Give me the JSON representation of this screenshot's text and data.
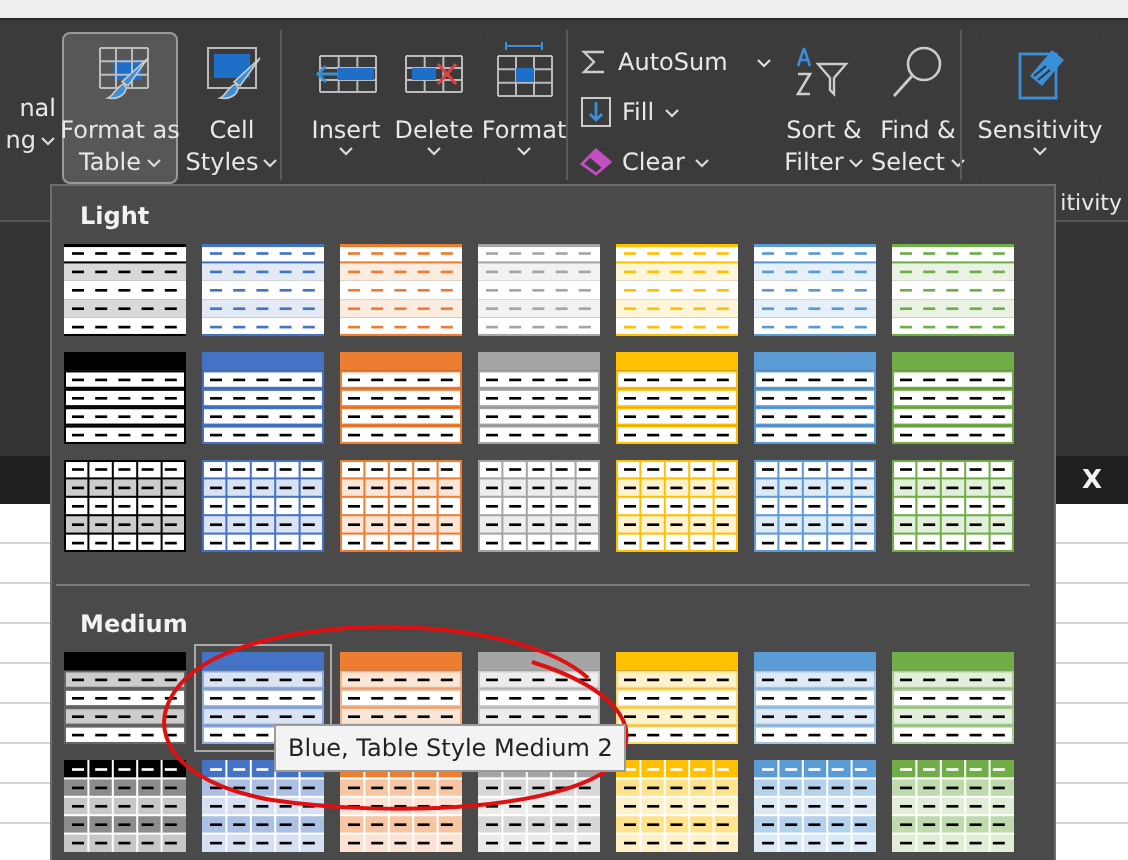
{
  "ribbon": {
    "groups": [
      {
        "buttons": [
          {
            "kind": "cut",
            "lines": [
              "nal",
              "ng"
            ],
            "dropdown": true
          }
        ]
      },
      {
        "buttons": [
          {
            "kind": "large",
            "lines": [
              "Format as",
              "Table"
            ],
            "dropdown": true,
            "pressed": true
          },
          {
            "kind": "large",
            "lines": [
              "Cell",
              "Styles"
            ],
            "dropdown": true,
            "pressed": false
          }
        ]
      },
      {
        "buttons": [
          {
            "kind": "large",
            "lines": [
              "Insert"
            ],
            "dropdown": true,
            "pressed": false
          },
          {
            "kind": "large",
            "lines": [
              "Delete"
            ],
            "dropdown": true,
            "pressed": false
          },
          {
            "kind": "large",
            "lines": [
              "Format"
            ],
            "dropdown": true,
            "pressed": false
          }
        ]
      },
      {
        "buttons": [
          {
            "kind": "stack",
            "items": [
              {
                "label": "AutoSum",
                "dropdown": true,
                "split": true
              },
              {
                "label": "Fill",
                "dropdown": true,
                "split": false
              },
              {
                "label": "Clear",
                "dropdown": true,
                "split": false
              }
            ]
          },
          {
            "kind": "large",
            "lines": [
              "Sort &",
              "Filter"
            ],
            "dropdown": true,
            "pressed": false
          },
          {
            "kind": "large",
            "lines": [
              "Find &",
              "Select"
            ],
            "dropdown": true,
            "pressed": false
          }
        ]
      },
      {
        "buttons": [
          {
            "kind": "large",
            "lines": [
              "Sensitivity"
            ],
            "dropdown": true,
            "pressed": false
          }
        ],
        "label": "itivity"
      }
    ]
  },
  "formula_bar": {
    "cancel": "X"
  },
  "gallery": {
    "sections": [
      {
        "title": "Light",
        "rows": [
          [
            {
              "kind": "light-banded",
              "color": "#000000",
              "selected": false
            },
            {
              "kind": "light-banded",
              "color": "#4472c4",
              "selected": false
            },
            {
              "kind": "light-banded",
              "color": "#ed7d31",
              "selected": false
            },
            {
              "kind": "light-banded",
              "color": "#a5a5a5",
              "selected": false
            },
            {
              "kind": "light-banded",
              "color": "#ffc000",
              "selected": false
            },
            {
              "kind": "light-banded",
              "color": "#5b9bd5",
              "selected": false
            },
            {
              "kind": "light-banded",
              "color": "#70ad47",
              "selected": false
            }
          ],
          [
            {
              "kind": "light-header",
              "color": "#000000",
              "selected": false
            },
            {
              "kind": "light-header",
              "color": "#4472c4",
              "selected": false
            },
            {
              "kind": "light-header",
              "color": "#ed7d31",
              "selected": false
            },
            {
              "kind": "light-header",
              "color": "#a5a5a5",
              "selected": false
            },
            {
              "kind": "light-header",
              "color": "#ffc000",
              "selected": false
            },
            {
              "kind": "light-header",
              "color": "#5b9bd5",
              "selected": false
            },
            {
              "kind": "light-header",
              "color": "#70ad47",
              "selected": false
            }
          ],
          [
            {
              "kind": "light-grid",
              "color": "#000000",
              "selected": false
            },
            {
              "kind": "light-grid",
              "color": "#4472c4",
              "selected": false
            },
            {
              "kind": "light-grid",
              "color": "#ed7d31",
              "selected": false
            },
            {
              "kind": "light-grid",
              "color": "#a5a5a5",
              "selected": false
            },
            {
              "kind": "light-grid",
              "color": "#ffc000",
              "selected": false
            },
            {
              "kind": "light-grid",
              "color": "#5b9bd5",
              "selected": false
            },
            {
              "kind": "light-grid",
              "color": "#70ad47",
              "selected": false
            }
          ]
        ]
      },
      {
        "title": "Medium",
        "rows": [
          [
            {
              "kind": "medium-banded",
              "color": "#000000",
              "selected": false
            },
            {
              "kind": "medium-banded",
              "color": "#4472c4",
              "selected": true
            },
            {
              "kind": "medium-banded",
              "color": "#ed7d31",
              "selected": false
            },
            {
              "kind": "medium-banded",
              "color": "#a5a5a5",
              "selected": false
            },
            {
              "kind": "medium-banded",
              "color": "#ffc000",
              "selected": false
            },
            {
              "kind": "medium-banded",
              "color": "#5b9bd5",
              "selected": false
            },
            {
              "kind": "medium-banded",
              "color": "#70ad47",
              "selected": false
            }
          ],
          [
            {
              "kind": "medium-grid",
              "color": "#000000",
              "selected": false
            },
            {
              "kind": "medium-grid",
              "color": "#4472c4",
              "selected": false
            },
            {
              "kind": "medium-grid",
              "color": "#ed7d31",
              "selected": false
            },
            {
              "kind": "medium-grid",
              "color": "#a5a5a5",
              "selected": false
            },
            {
              "kind": "medium-grid",
              "color": "#ffc000",
              "selected": false
            },
            {
              "kind": "medium-grid",
              "color": "#5b9bd5",
              "selected": false
            },
            {
              "kind": "medium-grid",
              "color": "#70ad47",
              "selected": false
            }
          ]
        ]
      }
    ],
    "tooltip": {
      "text": "Blue, Table Style Medium 2"
    },
    "circled": true
  }
}
